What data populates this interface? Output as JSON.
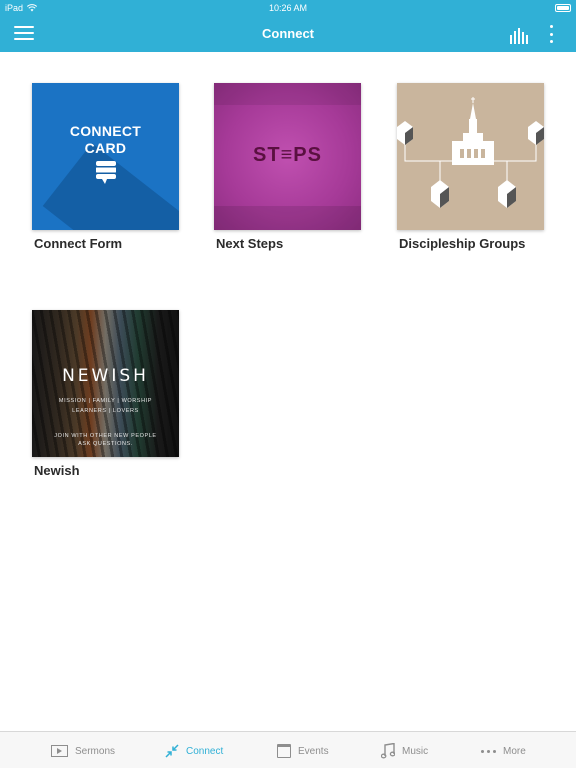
{
  "status": {
    "device": "iPad",
    "time": "10:26 AM"
  },
  "header": {
    "title": "Connect"
  },
  "tiles": [
    {
      "label": "Connect Form",
      "art_line1": "CONNECT",
      "art_line2": "CARD"
    },
    {
      "label": "Next Steps",
      "art_text": "ST≡PS"
    },
    {
      "label": "Discipleship Groups"
    },
    {
      "label": "Newish",
      "art_title": "NEWISH",
      "art_line1": "MISSION | FAMILY | WORSHIP",
      "art_line2": "LEARNERS | LOVERS",
      "art_line3": "JOIN WITH OTHER NEW PEOPLE",
      "art_line4": "ASK QUESTIONS."
    }
  ],
  "tabbar": {
    "items": [
      {
        "label": "Sermons",
        "icon": "sermons-icon"
      },
      {
        "label": "Connect",
        "icon": "connect-icon"
      },
      {
        "label": "Events",
        "icon": "calendar-icon"
      },
      {
        "label": "Music",
        "icon": "music-icon"
      },
      {
        "label": "More",
        "icon": "more-icon"
      }
    ],
    "active": "Connect"
  },
  "colors": {
    "accent": "#30b0d6",
    "text": "#2b2b2b",
    "tab_inactive": "#8e8e8e"
  }
}
